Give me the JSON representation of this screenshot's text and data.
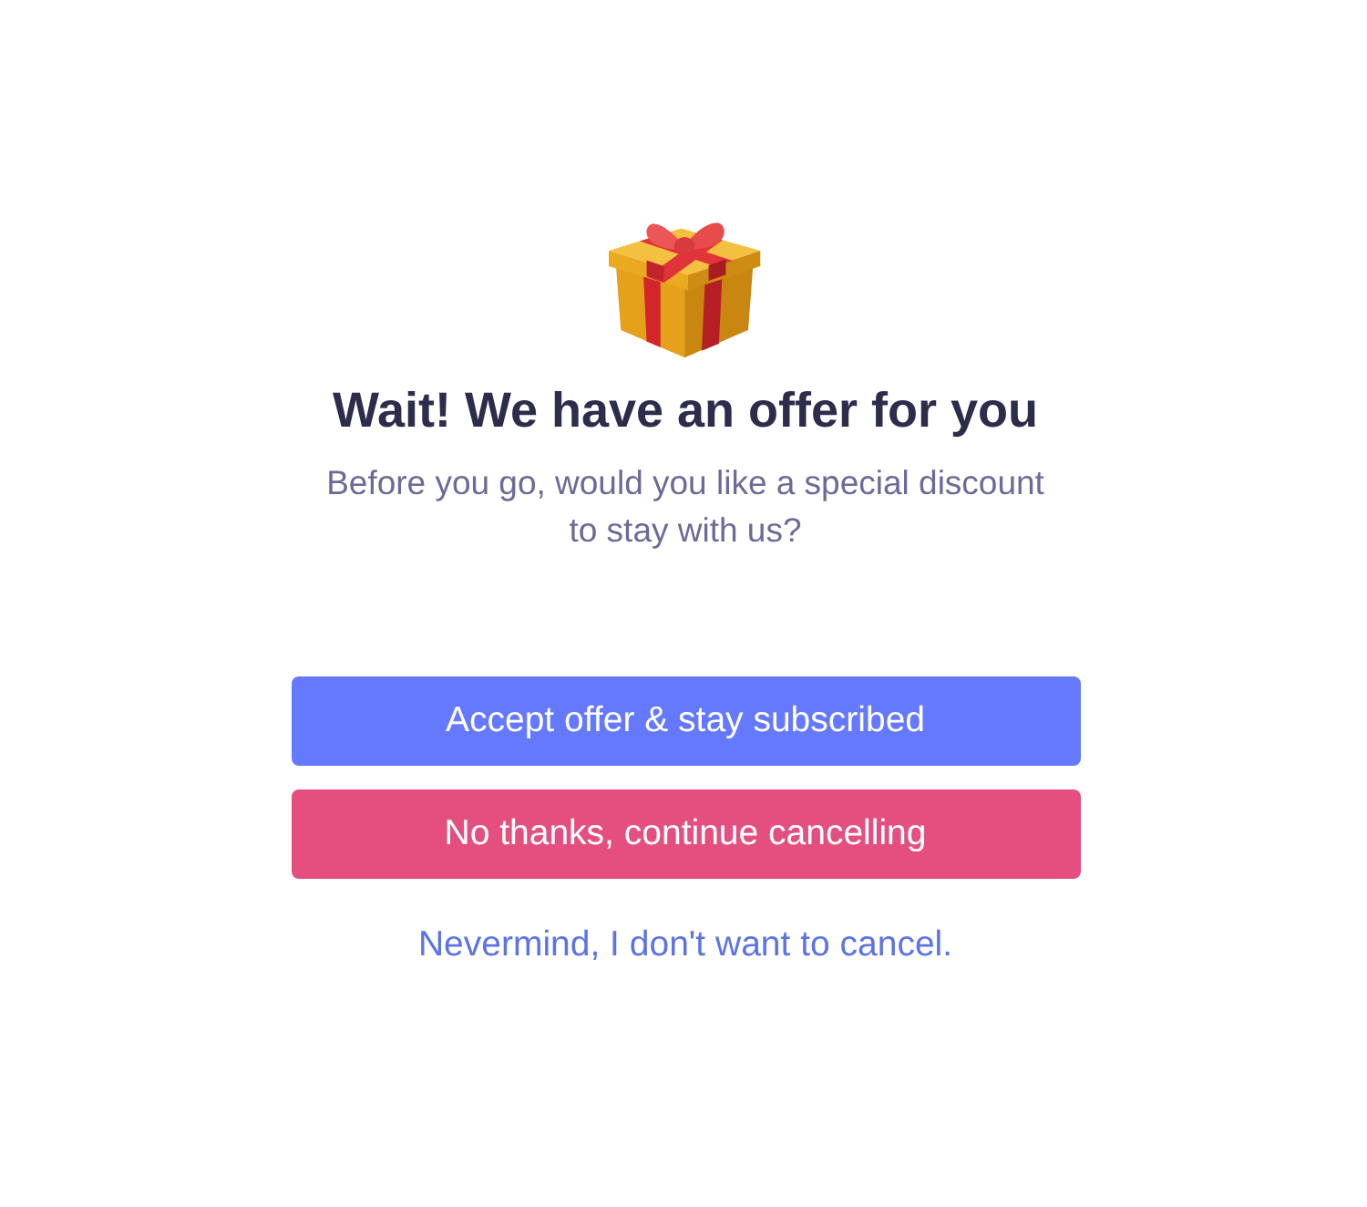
{
  "title": "Wait! We have an offer for you",
  "subtitle": "Before you go, would you like a special discount to stay with us?",
  "buttons": [
    {
      "label": "Accept offer & stay subscribed",
      "kind": "primary"
    },
    {
      "label": "No thanks, continue cancelling",
      "kind": "danger"
    }
  ],
  "link": {
    "label": "Nevermind, I don't want to cancel."
  }
}
